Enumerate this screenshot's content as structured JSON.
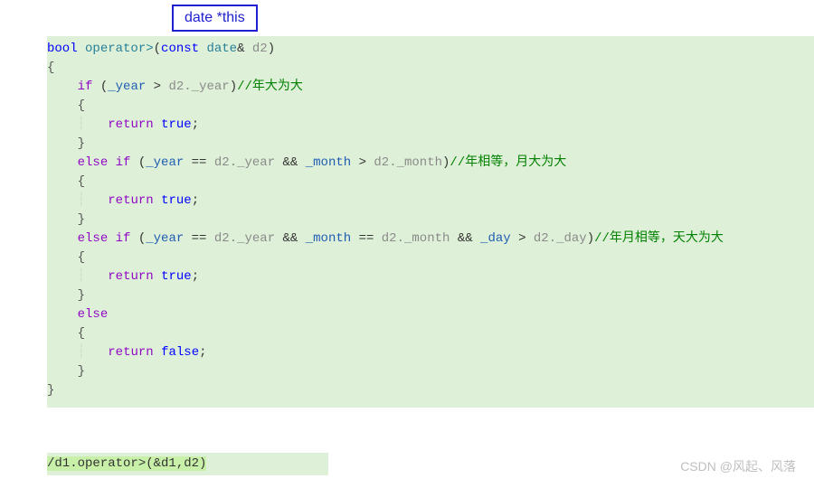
{
  "annotation": "date *this",
  "code": {
    "l0": "bool",
    "l0_op": "operator>",
    "l0_const": "const",
    "l0_type": "date",
    "l0_ref": "&",
    "l0_param": "d2",
    "brace_open": "{",
    "brace_close": "}",
    "if": "if",
    "else": "else",
    "else_if": "else if",
    "return": "return",
    "true": "true",
    "false": "false",
    "semi": ";",
    "gt": ">",
    "eq": "==",
    "and": "&&",
    "po": "(",
    "pc": ")",
    "y": "_year",
    "m": "_month",
    "d": "_day",
    "d2": "d2",
    "dot": ".",
    "c1": "//年大为大",
    "c2": "//年相等，月大为大",
    "c3": "//年月相等，天大为大",
    "guide": "┆"
  },
  "bottom": "/d1.operator>(&d1,d2)",
  "watermark": "CSDN @风起、风落"
}
